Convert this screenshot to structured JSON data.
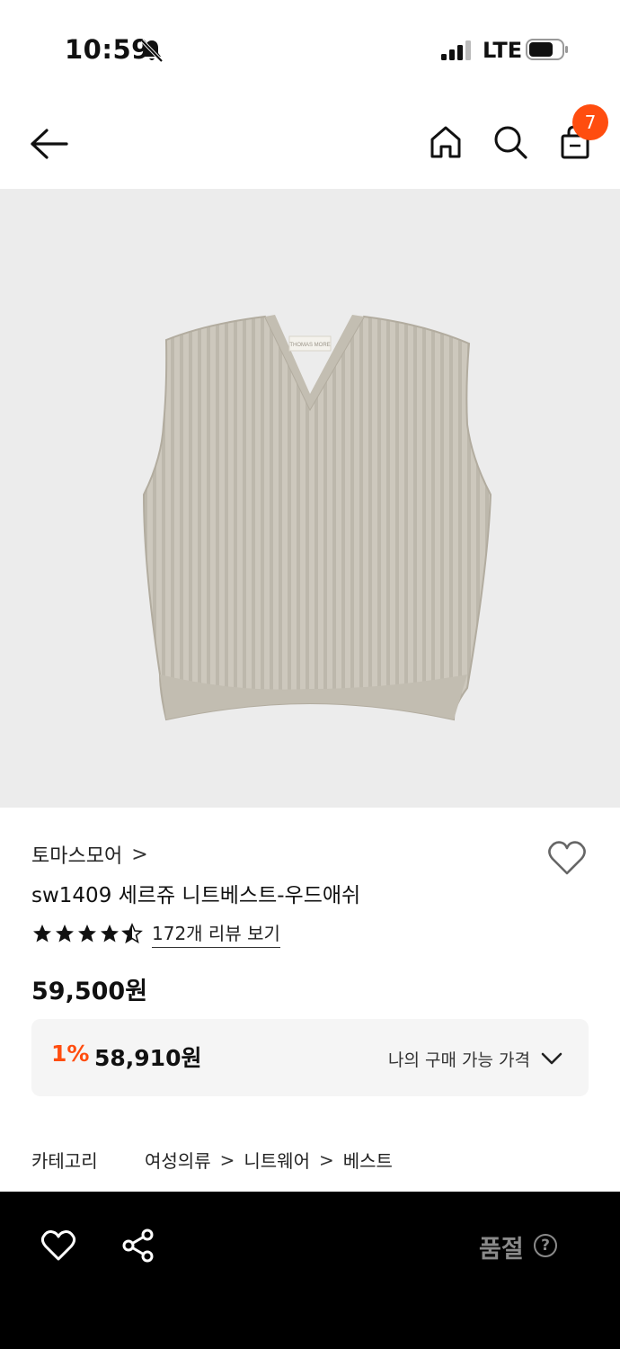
{
  "status_bar": {
    "time": "10:59",
    "network": "LTE",
    "bell_icon": "bell-muted-icon",
    "signal_icon": "signal-bars-icon",
    "battery_icon": "battery-icon"
  },
  "nav": {
    "back_icon": "arrow-left-icon",
    "home_icon": "home-icon",
    "search_icon": "search-icon",
    "cart_icon": "shopping-bag-icon",
    "cart_count": "7"
  },
  "product": {
    "brand": "토마스모어",
    "brand_chevron": ">",
    "name": "sw1409 세르쥬 니트베스트-우드애쉬",
    "rating": 4.5,
    "review_link": "172개 리뷰 보기",
    "price": "59,500원",
    "discount_rate": "1%",
    "discount_price": "58,910원",
    "my_price_label": "나의 구매 가능 가격",
    "image_label": "THOMAS MORE"
  },
  "category": {
    "label": "카테고리",
    "path": [
      "여성의류",
      "니트웨어",
      "베스트"
    ],
    "separator": ">"
  },
  "bottom_bar": {
    "soldout_label": "품절",
    "help_glyph": "?"
  },
  "colors": {
    "accent": "#ff4d0f",
    "image_bg": "#ececec",
    "price_box_bg": "#f5f5f5",
    "bottom_bar_bg": "#000000",
    "disabled_text": "#8a8a8a"
  }
}
